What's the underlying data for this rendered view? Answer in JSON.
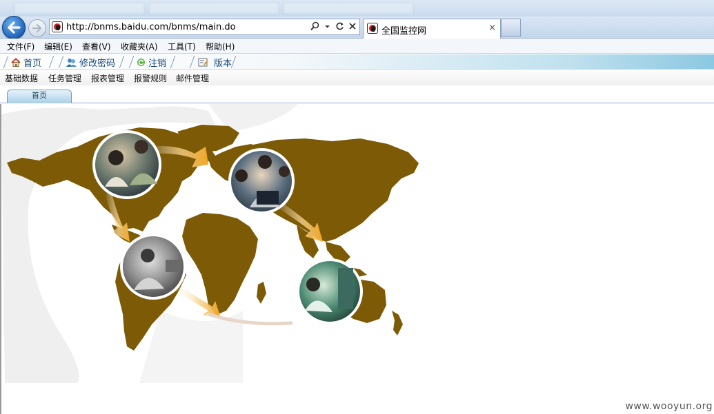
{
  "browser": {
    "url": "http://bnms.baidu.com/bnms/main.do",
    "tab_title": "全国监控网",
    "tab_close": "×",
    "menu": [
      "文件(F)",
      "编辑(E)",
      "查看(V)",
      "收藏夹(A)",
      "工具(T)",
      "帮助(H)"
    ]
  },
  "app": {
    "toolbar": {
      "home": "首页",
      "change_password": "修改密码",
      "logout": "注销",
      "version": "版本"
    },
    "modules": [
      "基础数据",
      "任务管理",
      "报表管理",
      "报警规则",
      "邮件管理"
    ],
    "active_tab": "首页"
  },
  "colors": {
    "map_land": "#7d5a05",
    "arrow": "#f3a623",
    "toolbar_text": "#1a4b7a"
  },
  "watermark": "www.wooyun.org"
}
